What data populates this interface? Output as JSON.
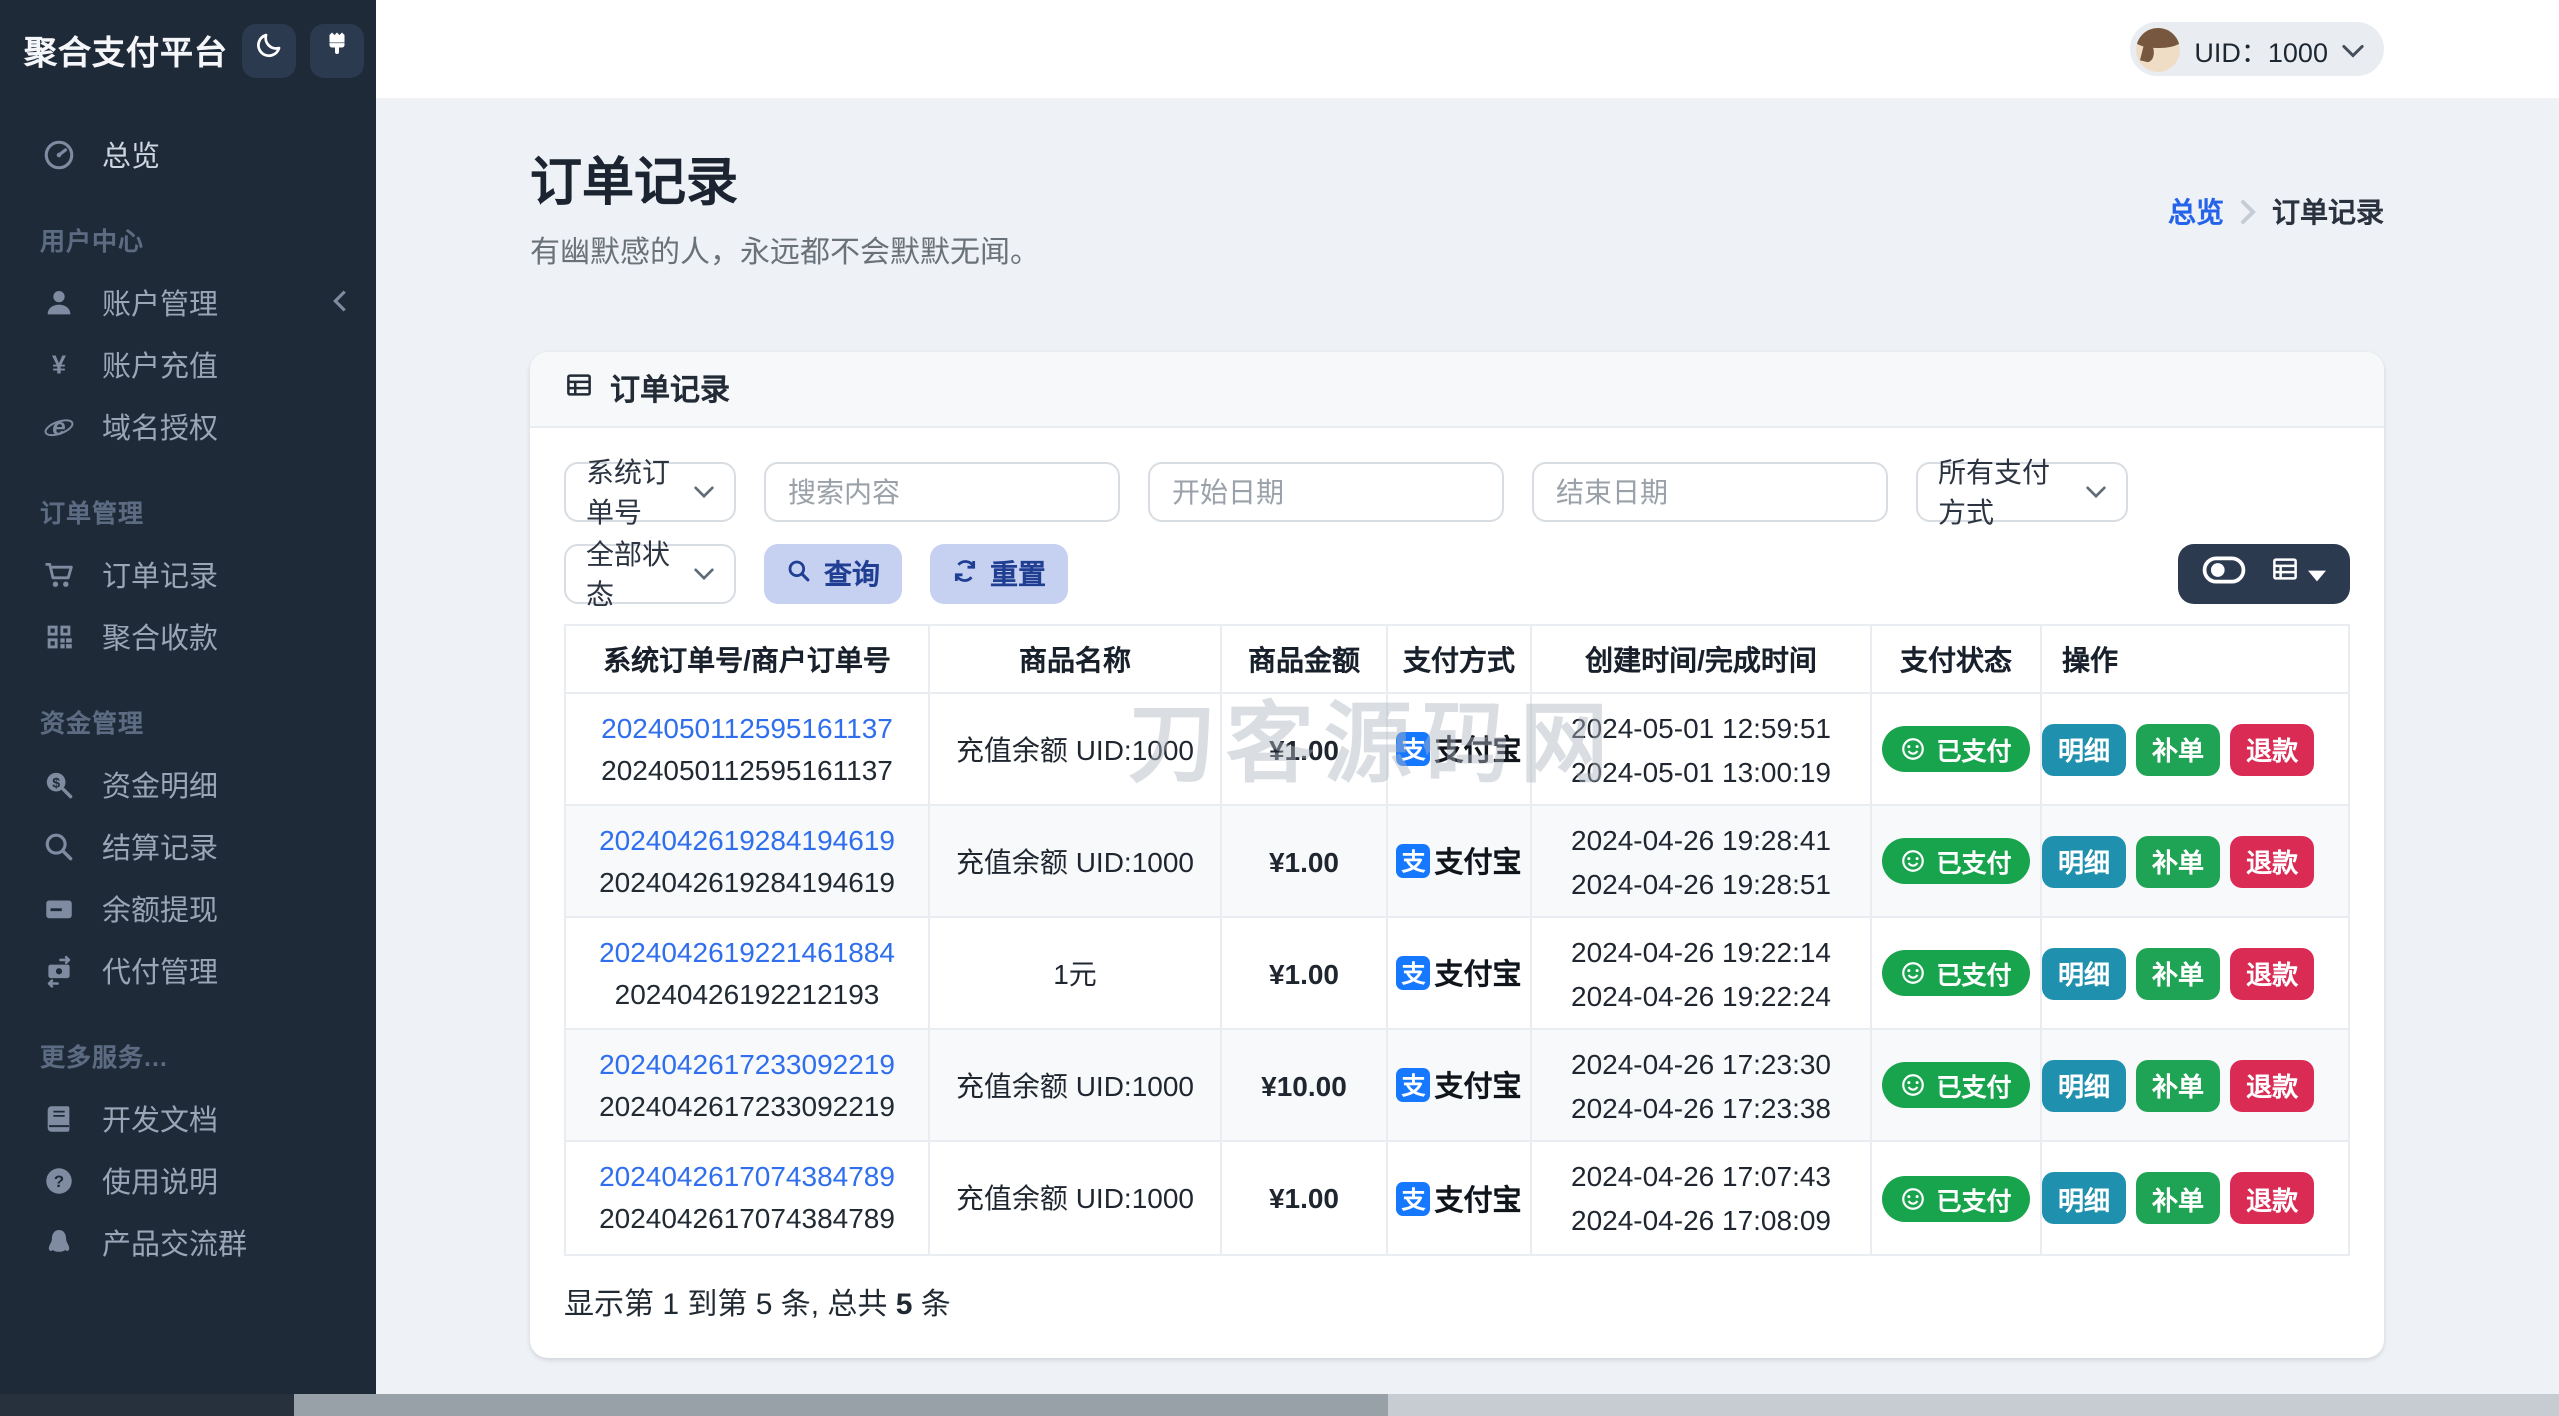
{
  "app": {
    "title": "聚合支付平台"
  },
  "topbar": {
    "uid": "UID：1000"
  },
  "sidebar": {
    "overview_label": "总览",
    "sections": [
      {
        "label": "用户中心",
        "items": [
          {
            "label": "账户管理"
          },
          {
            "label": "账户充值"
          },
          {
            "label": "域名授权"
          }
        ]
      },
      {
        "label": "订单管理",
        "items": [
          {
            "label": "订单记录"
          },
          {
            "label": "聚合收款"
          }
        ]
      },
      {
        "label": "资金管理",
        "items": [
          {
            "label": "资金明细"
          },
          {
            "label": "结算记录"
          },
          {
            "label": "余额提现"
          },
          {
            "label": "代付管理"
          }
        ]
      },
      {
        "label": "更多服务...",
        "items": [
          {
            "label": "开发文档"
          },
          {
            "label": "使用说明"
          },
          {
            "label": "产品交流群"
          }
        ]
      }
    ]
  },
  "page": {
    "title": "订单记录",
    "subtitle": "有幽默感的人，永远都不会默默无闻。",
    "breadcrumb_home": "总览",
    "breadcrumb_current": "订单记录"
  },
  "card": {
    "title": "订单记录"
  },
  "filters": {
    "search_type": "系统订单号",
    "search_placeholder": "搜索内容",
    "start_date_placeholder": "开始日期",
    "end_date_placeholder": "结束日期",
    "pay_method": "所有支付方式",
    "status": "全部状态",
    "query_label": "查询",
    "reset_label": "重置"
  },
  "table": {
    "columns": [
      "系统订单号/商户订单号",
      "商品名称",
      "商品金额",
      "支付方式",
      "创建时间/完成时间",
      "支付状态",
      "操作"
    ],
    "alipay_char": "支",
    "actions": {
      "detail": "明细",
      "reissue": "补单",
      "refund": "退款"
    },
    "rows": [
      {
        "order_no": "2024050112595161137",
        "merchant_no": "2024050112595161137",
        "product": "充值余额 UID:1000",
        "amount": "¥1.00",
        "pay_method": "支付宝",
        "created": "2024-05-01 12:59:51",
        "completed": "2024-05-01 13:00:19",
        "status": "已支付"
      },
      {
        "order_no": "2024042619284194619",
        "merchant_no": "2024042619284194619",
        "product": "充值余额 UID:1000",
        "amount": "¥1.00",
        "pay_method": "支付宝",
        "created": "2024-04-26 19:28:41",
        "completed": "2024-04-26 19:28:51",
        "status": "已支付"
      },
      {
        "order_no": "2024042619221461884",
        "merchant_no": "20240426192212193",
        "product": "1元",
        "amount": "¥1.00",
        "pay_method": "支付宝",
        "created": "2024-04-26 19:22:14",
        "completed": "2024-04-26 19:22:24",
        "status": "已支付"
      },
      {
        "order_no": "2024042617233092219",
        "merchant_no": "2024042617233092219",
        "product": "充值余额 UID:1000",
        "amount": "¥10.00",
        "pay_method": "支付宝",
        "created": "2024-04-26 17:23:30",
        "completed": "2024-04-26 17:23:38",
        "status": "已支付"
      },
      {
        "order_no": "2024042617074384789",
        "merchant_no": "2024042617074384789",
        "product": "充值余额 UID:1000",
        "amount": "¥1.00",
        "pay_method": "支付宝",
        "created": "2024-04-26 17:07:43",
        "completed": "2024-04-26 17:08:09",
        "status": "已支付"
      }
    ]
  },
  "summary": {
    "prefix": "显示第 1 到第 5 条, 总共 ",
    "total": "5",
    "suffix": " 条"
  },
  "watermark": "刀客源码网",
  "colors": {
    "sidebar_bg": "#1f2a39",
    "accent_blue": "#2f6fed",
    "breadcrumb_blue": "#2563eb",
    "badge_green": "#18a44c",
    "btn_teal": "#1f90ae",
    "btn_green": "#1fa455",
    "btn_red": "#da2b55",
    "soft_btn_bg": "#c6d1f2",
    "soft_btn_text": "#203e92",
    "alipay_blue": "#1677ff"
  }
}
